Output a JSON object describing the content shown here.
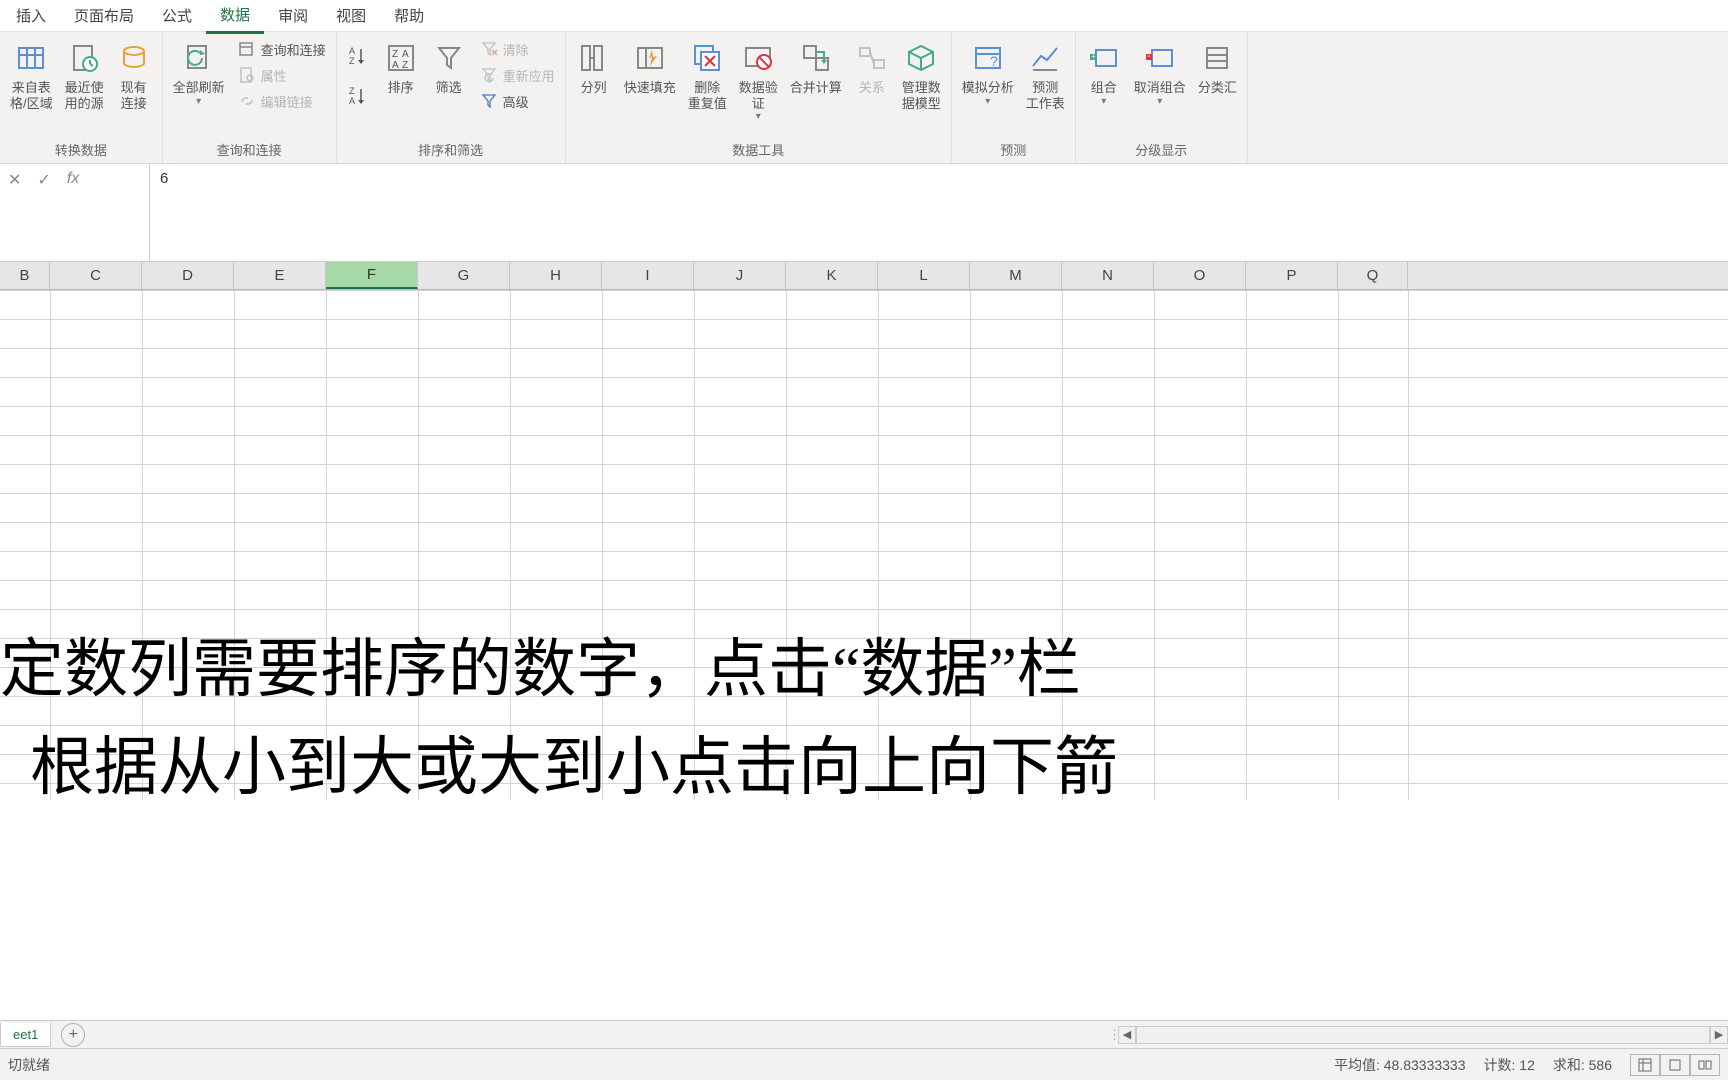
{
  "tabs": {
    "t1": "插入",
    "t2": "页面布局",
    "t3": "公式",
    "t4": "数据",
    "t5": "审阅",
    "t6": "视图",
    "t7": "帮助"
  },
  "ribbon": {
    "g1": {
      "label": "转换数据",
      "b1": "来自表\n格/区域",
      "b2": "最近使\n用的源",
      "b3": "现有\n连接"
    },
    "g2": {
      "label": "查询和连接",
      "b1": "全部刷新",
      "m1": "查询和连接",
      "m2": "属性",
      "m3": "编辑链接"
    },
    "g3": {
      "label": "排序和筛选",
      "b2": "排序",
      "b3": "筛选",
      "m1": "清除",
      "m2": "重新应用",
      "m3": "高级"
    },
    "g4": {
      "label": "数据工具",
      "b1": "分列",
      "b2": "快速填充",
      "b3": "删除\n重复值",
      "b4": "数据验\n证",
      "b5": "合并计算",
      "b6": "关系",
      "b7": "管理数\n据模型"
    },
    "g5": {
      "label": "预测",
      "b1": "模拟分析",
      "b2": "预测\n工作表"
    },
    "g6": {
      "label": "分级显示",
      "b1": "组合",
      "b2": "取消组合",
      "b3": "分类汇"
    }
  },
  "fbar": {
    "value": "6"
  },
  "cols": [
    "B",
    "C",
    "D",
    "E",
    "F",
    "G",
    "H",
    "I",
    "J",
    "K",
    "L",
    "M",
    "N",
    "O",
    "P",
    "Q"
  ],
  "selectedCol": "F",
  "overlay": {
    "l1": "定数列需要排序的数字，点击“数据”栏",
    "l2": "根据从小到大或大到小点击向上向下箭"
  },
  "sheet": {
    "name": "eet1"
  },
  "status": {
    "ready": "切就绪",
    "avg": "平均值: 48.83333333",
    "count": "计数: 12",
    "sum": "求和: 586"
  }
}
